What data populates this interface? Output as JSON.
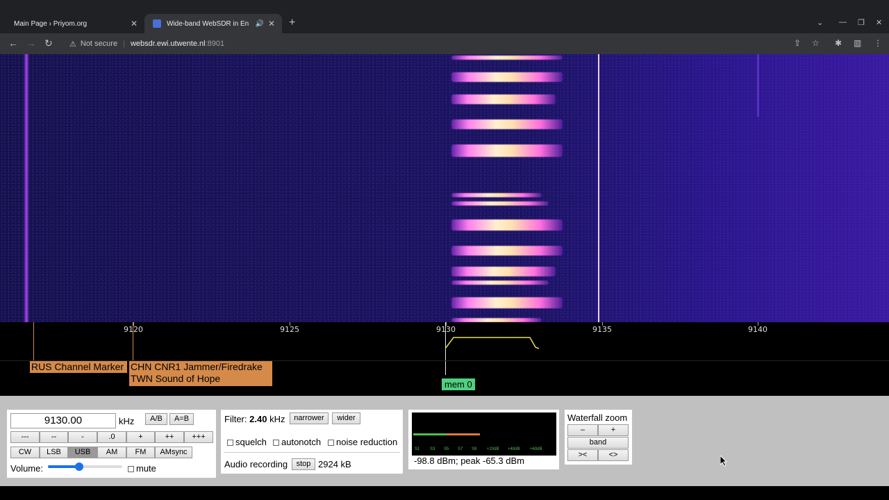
{
  "browser": {
    "tabs": [
      {
        "title": "Main Page › Priyom.org",
        "active": false
      },
      {
        "title": "Wide-band WebSDR in Ensch",
        "active": true
      }
    ],
    "url": {
      "security": "Not secure",
      "host": "websdr.ewi.utwente.nl",
      "port": ":8901"
    }
  },
  "scale": {
    "ticks": [
      "9120",
      "9125",
      "9130",
      "9135",
      "9140"
    ],
    "labels": [
      {
        "text": "RUS Channel Marker"
      },
      {
        "text": "CHN CNR1 Jammer/Firedrake"
      },
      {
        "text": "TWN Sound of Hope"
      }
    ],
    "memory_tag": "mem 0"
  },
  "frequency": {
    "value": "9130.00",
    "unit": "kHz",
    "ab_label": "A/B",
    "aeqb_label": "A=B"
  },
  "step_buttons": [
    "---",
    "--",
    "-",
    ".0",
    "+",
    "++",
    "+++"
  ],
  "modes": [
    "CW",
    "LSB",
    "USB",
    "AM",
    "FM",
    "AMsync"
  ],
  "active_mode": "USB",
  "volume": {
    "label": "Volume:",
    "level": 0.42,
    "mute_label": "mute"
  },
  "filter": {
    "label": "Filter:",
    "bandwidth": "2.40",
    "unit": "kHz",
    "narrower": "narrower",
    "wider": "wider"
  },
  "options": {
    "squelch": "squelch",
    "autonotch": "autonotch",
    "noise_reduction": "noise reduction"
  },
  "recording": {
    "label": "Audio recording",
    "stop": "stop",
    "size": "2924 kB"
  },
  "smeter": {
    "reading": "-98.8 dBm; peak  -65.3 dBm",
    "scale_labels": [
      "S1",
      "S3",
      "S5",
      "S7",
      "S9",
      "+20dB",
      "+40dB",
      "+60dB"
    ]
  },
  "waterfall_zoom": {
    "title": "Waterfall zoom",
    "minus": "–",
    "plus": "+",
    "band": "band",
    "shrink": "><",
    "expand": "<>"
  },
  "colors": {
    "label_bg": "#d58a4a",
    "mem_bg": "#50d080",
    "tuned_line": "#f0d0e8",
    "passband": "#e8e050"
  }
}
